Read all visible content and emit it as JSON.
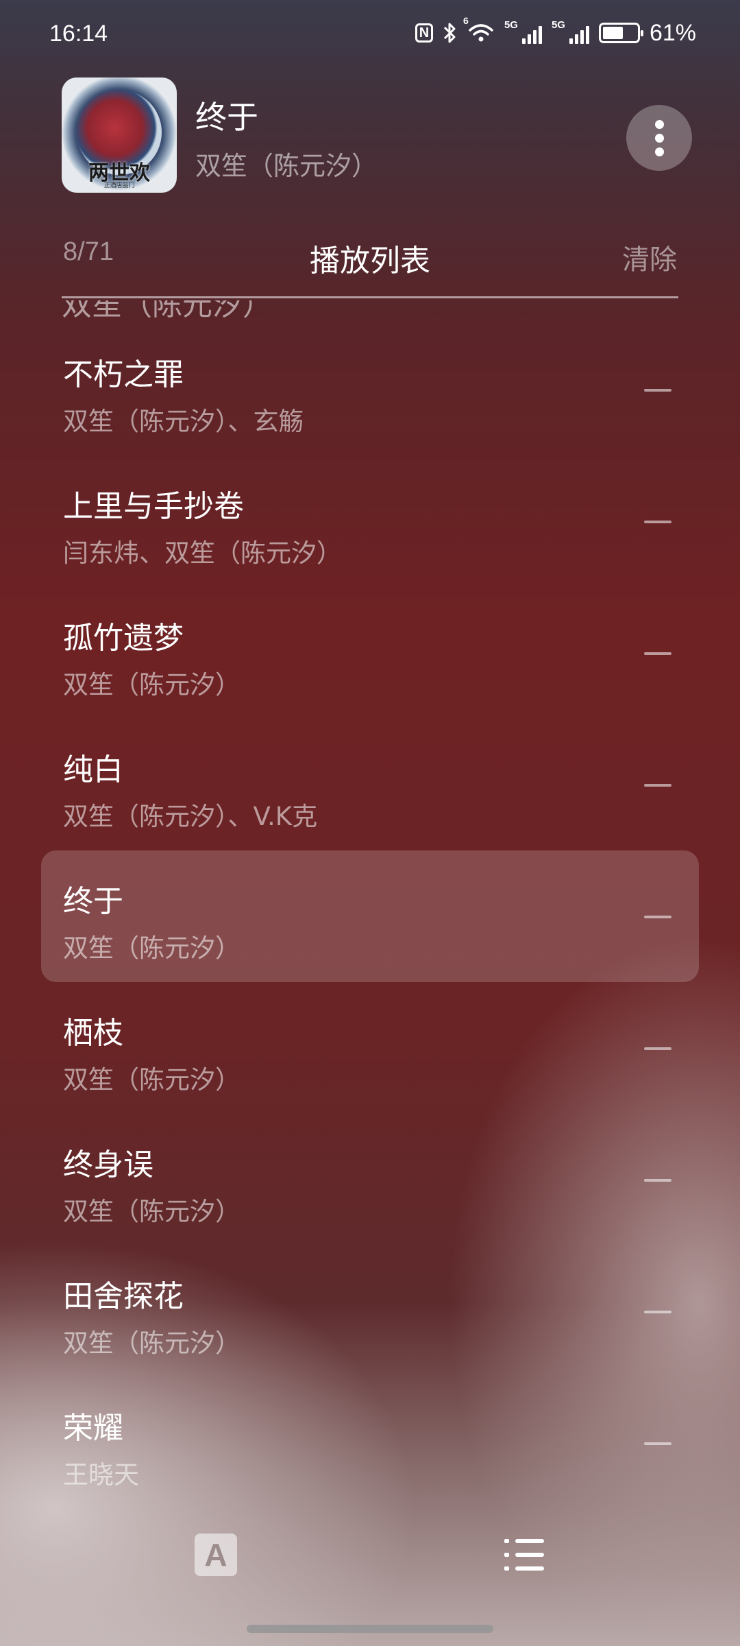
{
  "status_bar": {
    "time": "16:14",
    "nfc_label": "N",
    "wifi_tag": "6",
    "signal1_tag": "5G",
    "signal2_tag": "5G",
    "battery_percent": "61%",
    "battery_level": 0.61
  },
  "now_playing": {
    "title": "终于",
    "artist": "双笙（陈元汐）",
    "album_art_title": "两世欢",
    "album_art_subtitle": "正酒店品门"
  },
  "playlist": {
    "count": "8/71",
    "title": "播放列表",
    "clear_label": "清除",
    "peek_text": "双笙（陈元汐）",
    "songs": [
      {
        "title": "不朽之罪",
        "artist": "双笙（陈元汐）、玄觞"
      },
      {
        "title": "上里与手抄卷",
        "artist": "闫东炜、双笙（陈元汐）"
      },
      {
        "title": "孤竹遗梦",
        "artist": "双笙（陈元汐）"
      },
      {
        "title": "纯白",
        "artist": "双笙（陈元汐）、V.K克"
      },
      {
        "title": "终于",
        "artist": "双笙（陈元汐）"
      },
      {
        "title": "栖枝",
        "artist": "双笙（陈元汐）"
      },
      {
        "title": "终身误",
        "artist": "双笙（陈元汐）"
      },
      {
        "title": "田舍探花",
        "artist": "双笙（陈元汐）"
      },
      {
        "title": "荣耀",
        "artist": "王晓天"
      }
    ],
    "active_index": 4
  },
  "bottom_bar": {
    "lyrics_icon_letter": "A"
  },
  "icons": {
    "more": "more-vertical-icon",
    "remove": "minus-icon",
    "lyrics": "lyrics-icon",
    "list": "list-icon"
  }
}
